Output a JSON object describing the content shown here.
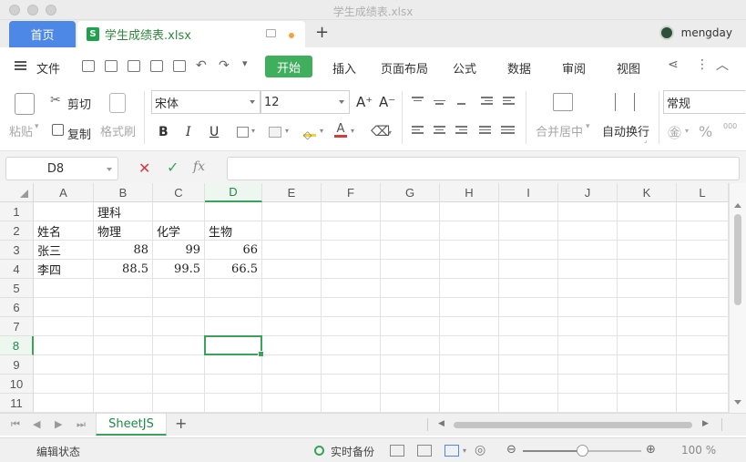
{
  "window": {
    "title": "学生成绩表.xlsx"
  },
  "tabs": {
    "home": "首页",
    "file": "学生成绩表.xlsx",
    "add": "+"
  },
  "user": {
    "name": "mengday"
  },
  "menu": {
    "file": "文件",
    "items": [
      "开始",
      "插入",
      "页面布局",
      "公式",
      "数据",
      "审阅",
      "视图"
    ]
  },
  "ribbon": {
    "paste": "粘贴",
    "cut": "剪切",
    "copy": "复制",
    "format_painter": "格式刷",
    "font_name": "宋体",
    "font_size": "12",
    "grow_font": "A⁺",
    "shrink_font": "A⁻",
    "bold": "B",
    "italic": "I",
    "underline": "U",
    "merge_center": "合并居中",
    "wrap_text": "自动换行",
    "number_format": "常规",
    "percent": "%"
  },
  "formula_bar": {
    "name_box": "D8",
    "fx": "fx",
    "value": ""
  },
  "grid": {
    "columns": [
      "A",
      "B",
      "C",
      "D",
      "E",
      "F",
      "G",
      "H",
      "I",
      "J",
      "K",
      "L"
    ],
    "rows": [
      "1",
      "2",
      "3",
      "4",
      "5",
      "6",
      "7",
      "8",
      "9",
      "10",
      "11"
    ],
    "active_column": "D",
    "active_row": "8",
    "cells": {
      "B1": "理科",
      "A2": "姓名",
      "B2": "物理",
      "C2": "化学",
      "D2": "生物",
      "A3": "张三",
      "B3": "88",
      "C3": "99",
      "D3": "66",
      "A4": "李四",
      "B4": "88.5",
      "C4": "99.5",
      "D4": "66.5"
    }
  },
  "sheets": {
    "tabs": [
      "SheetJS"
    ],
    "add": "+"
  },
  "status": {
    "mode": "编辑状态",
    "backup": "实时备份",
    "zoom": "100 %",
    "zoom_level": 0.5
  },
  "colors": {
    "accent": "#3aa35a",
    "home_tab": "#4e88e6",
    "file_text": "#2c8a3c"
  }
}
